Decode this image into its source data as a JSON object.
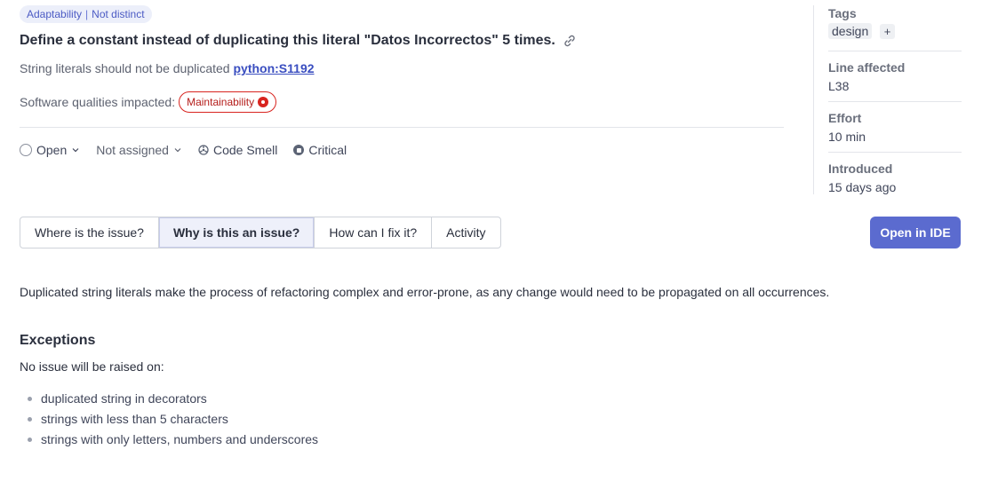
{
  "badge": {
    "attribute": "Adaptability",
    "separator": "|",
    "value": "Not distinct"
  },
  "issue": {
    "title": "Define a constant instead of duplicating this literal \"Datos Incorrectos\" 5 times.",
    "rule_text": "String literals should not be duplicated",
    "rule_key": "python:S1192",
    "qualities_label": "Software qualities impacted:",
    "quality": "Maintainability"
  },
  "status": {
    "state": "Open",
    "assignee": "Not assigned",
    "type": "Code Smell",
    "severity": "Critical"
  },
  "sidebar": {
    "tags_label": "Tags",
    "tag": "design",
    "tag_add": "+",
    "line_label": "Line affected",
    "line_value": "L38",
    "effort_label": "Effort",
    "effort_value": "10 min",
    "introduced_label": "Introduced",
    "introduced_value": "15 days ago"
  },
  "tabs": [
    {
      "label": "Where is the issue?"
    },
    {
      "label": "Why is this an issue?"
    },
    {
      "label": "How can I fix it?"
    },
    {
      "label": "Activity"
    }
  ],
  "active_tab": "Why is this an issue?",
  "open_ide_label": "Open in IDE",
  "content": {
    "description": "Duplicated string literals make the process of refactoring complex and error-prone, as any change would need to be propagated on all occurrences.",
    "exceptions_title": "Exceptions",
    "exceptions_intro": "No issue will be raised on:",
    "exceptions": [
      "duplicated string in decorators",
      "strings with less than 5 characters",
      "strings with only letters, numbers and underscores"
    ]
  },
  "colors": {
    "accent": "#5b6bcf",
    "quality_red": "#d8241f",
    "badge_bg": "#eceffa"
  }
}
